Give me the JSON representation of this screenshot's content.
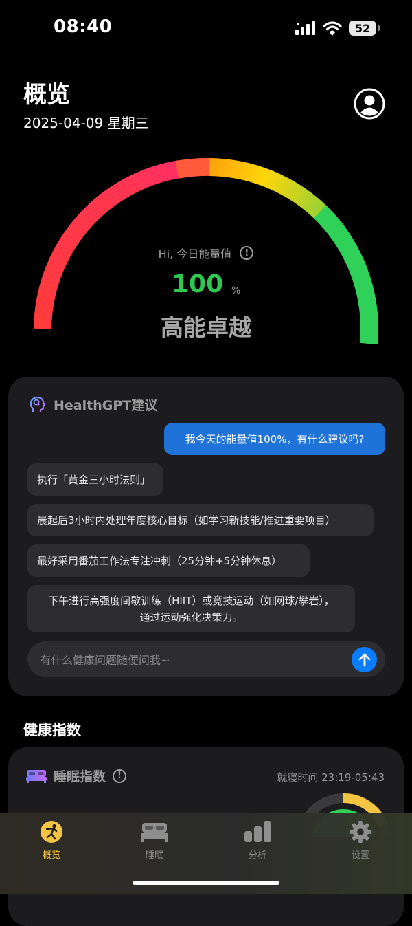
{
  "status_bar": {
    "time": "08:40",
    "battery": "52"
  },
  "header": {
    "title": "概览",
    "date": "2025-04-09 星期三"
  },
  "gauge": {
    "label": "Hi, 今日能量值",
    "value": "100",
    "unit": "%",
    "level_fraction": 1.0,
    "status": "高能卓越",
    "colors": {
      "red": "#ff3b3b",
      "pink": "#ff2d5f",
      "orange": "#ff9f0a",
      "yellow": "#ffd60a",
      "green": "#30d158"
    }
  },
  "healthgpt": {
    "title": "HealthGPT建议",
    "user_message": "我今天的能量值100%，有什么建议吗?",
    "replies": [
      "执行「黄金三小时法则」",
      "晨起后3小时内处理年度核心目标（如学习新技能/推进重要项目）",
      "最好采用番茄工作法专注冲刺（25分钟+5分钟休息）",
      "下午进行高强度间歇训练（HIIT）或竞技运动（如网球/攀岩），",
      "通过运动强化决策力。"
    ],
    "input_placeholder": "有什么健康问题随便问我~",
    "accent": "#1e72d8"
  },
  "health_index": {
    "section_title": "健康指数",
    "sleep": {
      "title": "睡眠指数",
      "time_label": "就寝时间 23:19-05:43"
    }
  },
  "tabs": [
    {
      "label": "概览",
      "icon": "overview-icon",
      "active": true
    },
    {
      "label": "睡眠",
      "icon": "bed-icon",
      "active": false
    },
    {
      "label": "分析",
      "icon": "bar-chart-icon",
      "active": false
    },
    {
      "label": "设置",
      "icon": "gear-icon",
      "active": false
    }
  ]
}
